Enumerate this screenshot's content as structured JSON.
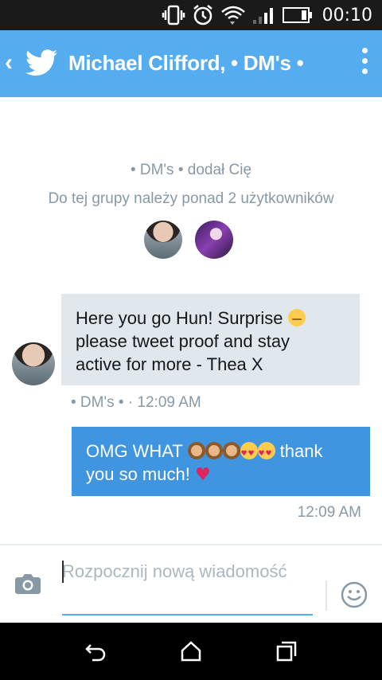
{
  "status_bar": {
    "time": "00:10"
  },
  "app_bar": {
    "title": "Michael Clifford, • DM's •"
  },
  "group_info": {
    "added_text": "• DM's • dodał Cię",
    "members_text": "Do tej grupy należy ponad 2 użytkowników"
  },
  "messages": [
    {
      "direction": "incoming",
      "line1": "Here you go Hun! Surprise",
      "line2": "please tweet proof and stay",
      "line3": "active for more - Thea X",
      "meta": "• DM's • · 12:09 AM"
    },
    {
      "direction": "outgoing",
      "line1_text": "OMG WHAT",
      "line1_end": "thank",
      "line2": "you so much!",
      "time": "12:09 AM"
    }
  ],
  "compose": {
    "placeholder": "Rozpocznij nową wiadomość"
  },
  "colors": {
    "brand_blue": "#55acee",
    "outgoing_bubble": "#3f95e0",
    "incoming_bubble": "#e1e8ed",
    "muted_text": "#8899a6"
  },
  "icons": [
    "battery-icon",
    "twitter-bird-icon",
    "overflow-menu-icon",
    "camera-icon",
    "smiley-icon",
    "nav-back-icon",
    "nav-home-icon",
    "nav-recents-icon"
  ]
}
